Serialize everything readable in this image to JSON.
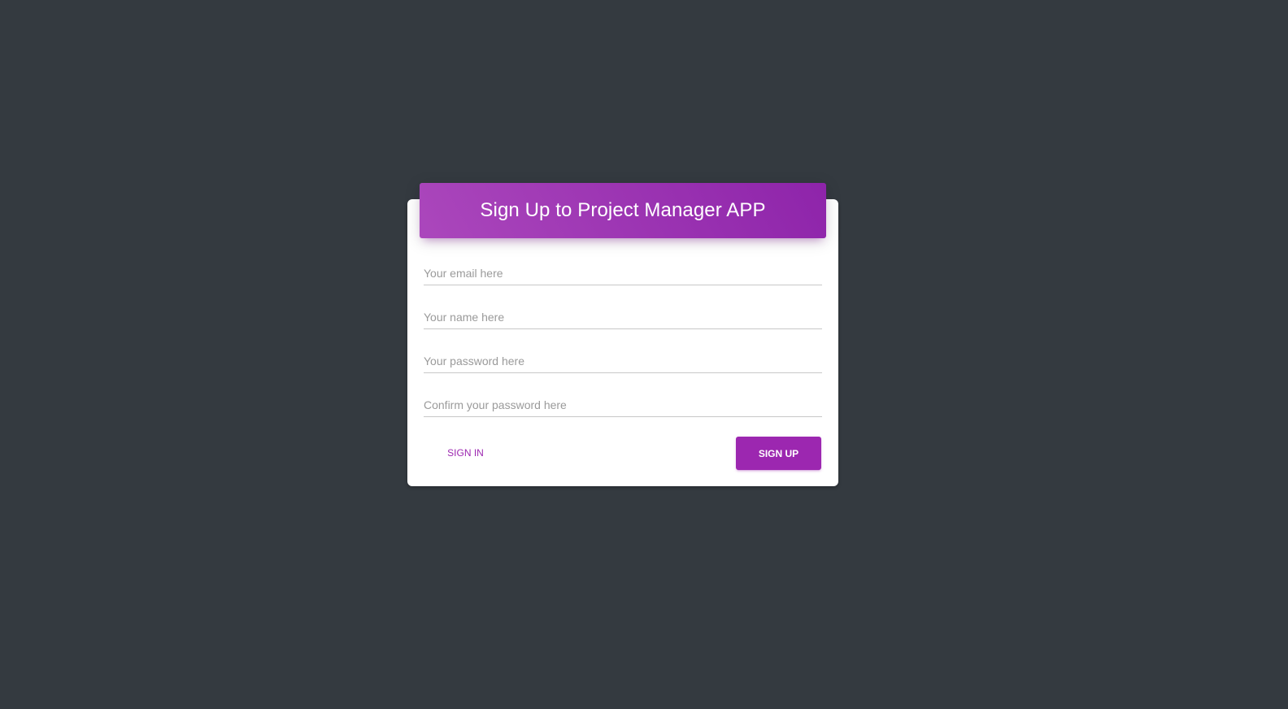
{
  "form": {
    "title": "Sign Up to Project Manager APP",
    "fields": {
      "email": {
        "placeholder": "Your email here",
        "value": ""
      },
      "name": {
        "placeholder": "Your name here",
        "value": ""
      },
      "password": {
        "placeholder": "Your password here",
        "value": ""
      },
      "confirm_password": {
        "placeholder": "Confirm your password here",
        "value": ""
      }
    },
    "signin_label": "SIGN IN",
    "signup_label": "SIGN UP"
  },
  "colors": {
    "background": "#343a40",
    "accent": "#9c27b0",
    "header_gradient_start": "#ab47bc",
    "header_gradient_end": "#8e24aa",
    "card": "#ffffff"
  }
}
